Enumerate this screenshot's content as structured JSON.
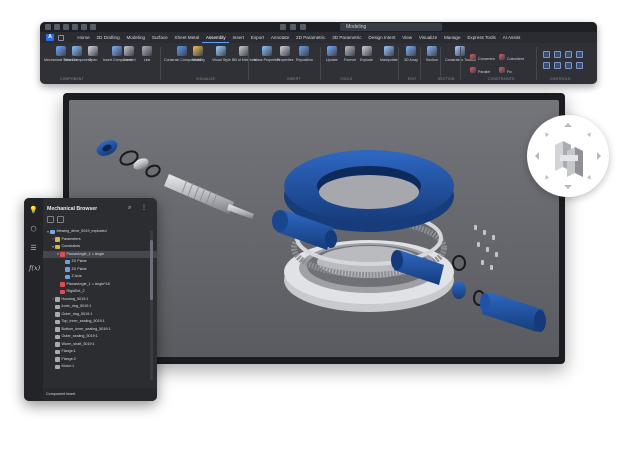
{
  "ribbon": {
    "document_name": "Modeling",
    "app_button": "A",
    "tabs": [
      "Home",
      "2D Drafting",
      "Modeling",
      "Surface",
      "Sheet Metal",
      "Assembly",
      "Insert",
      "Export",
      "Annotate",
      "2D Parametric",
      "3D Parametric",
      "Design Intent",
      "View",
      "Visualize",
      "Manage",
      "Express Tools",
      "AI Assist"
    ],
    "active_tab": "Assembly",
    "tools": [
      {
        "label": "Mechanical Structure",
        "icon": "mechanical-structure-icon"
      },
      {
        "label": "New Component",
        "icon": "new-component-icon"
      },
      {
        "label": "Open",
        "icon": "open-icon"
      },
      {
        "label": "Insert Component",
        "icon": "insert-component-icon"
      },
      {
        "label": "Convert",
        "icon": "convert-icon"
      },
      {
        "label": "Link",
        "icon": "link-icon"
      },
      {
        "label": "Constrain Components",
        "icon": "constrain-components-icon"
      },
      {
        "label": "Visibility",
        "icon": "visibility-icon"
      },
      {
        "label": "Visual Style",
        "icon": "visual-style-icon"
      },
      {
        "label": "Bill of Materials",
        "icon": "bill-of-materials-icon"
      },
      {
        "label": "Mass Properties",
        "icon": "mass-properties-icon"
      },
      {
        "label": "Properties",
        "icon": "properties-icon"
      },
      {
        "label": "Reposition",
        "icon": "reposition-icon"
      },
      {
        "label": "Update",
        "icon": "update-icon"
      },
      {
        "label": "Forever",
        "icon": "forever-icon"
      },
      {
        "label": "Explode",
        "icon": "explode-icon"
      },
      {
        "label": "Manipulate",
        "icon": "manipulate-icon"
      },
      {
        "label": "3D Array",
        "icon": "3d-array-icon"
      },
      {
        "label": "Section",
        "icon": "section-icon"
      },
      {
        "label": "Constraints Toolbar",
        "icon": "constraints-toolbar-icon"
      },
      {
        "label": "Concentric",
        "icon": "concentric-icon"
      },
      {
        "label": "Parallel",
        "icon": "parallel-icon"
      },
      {
        "label": "Coincident",
        "icon": "coincident-icon"
      },
      {
        "label": "Fix",
        "icon": "fix-icon"
      }
    ],
    "groups": [
      "COMPONENT",
      "VISUALIZE",
      "INSERT",
      "TOOLS",
      "EDIT",
      "SECTION",
      "CONSTRAINTS",
      "CONTROLS"
    ]
  },
  "browser": {
    "title": "Mechanical Browser",
    "side_icons": [
      "lightbulb-icon",
      "cube-icon",
      "tree-icon"
    ],
    "side_fx": "f(x)",
    "tree": [
      {
        "level": 0,
        "twisty": "▾",
        "icon": "assembly",
        "label": "Mewing_drive_5019_exploded"
      },
      {
        "level": 1,
        "twisty": "›",
        "icon": "folder",
        "label": "Parameters"
      },
      {
        "level": 1,
        "twisty": "▾",
        "icon": "folder",
        "label": "Constraints"
      },
      {
        "level": 2,
        "twisty": "▾",
        "icon": "constraint",
        "label": "PlanarAngle_1 = Angle",
        "selected": true
      },
      {
        "level": 3,
        "twisty": "",
        "icon": "plane",
        "label": "ZX Plane"
      },
      {
        "level": 3,
        "twisty": "",
        "icon": "plane",
        "label": "ZX Plane"
      },
      {
        "level": 3,
        "twisty": "",
        "icon": "axis",
        "label": "Z Axis"
      },
      {
        "level": 2,
        "twisty": "",
        "icon": "constraint",
        "label": "PlanarAngle_1 = Angle*18"
      },
      {
        "level": 2,
        "twisty": "",
        "icon": "constraint",
        "label": "RigidSet_2"
      },
      {
        "level": 1,
        "twisty": "›",
        "icon": "part",
        "label": "Housing_5019:1"
      },
      {
        "level": 1,
        "twisty": "",
        "icon": "part",
        "label": "Inner_ring_5019:1"
      },
      {
        "level": 1,
        "twisty": "",
        "icon": "part",
        "label": "Outer_ring_5019:1"
      },
      {
        "level": 1,
        "twisty": "",
        "icon": "part",
        "label": "Top_inner_sealing_5019:1"
      },
      {
        "level": 1,
        "twisty": "",
        "icon": "part",
        "label": "Bottom_inner_sealing_5019:1"
      },
      {
        "level": 1,
        "twisty": "",
        "icon": "part",
        "label": "Outer_sealing_5019:1"
      },
      {
        "level": 1,
        "twisty": "",
        "icon": "part",
        "label": "Worm_shaft_5019:1"
      },
      {
        "level": 1,
        "twisty": "",
        "icon": "part",
        "label": "Flange:1"
      },
      {
        "level": 1,
        "twisty": "",
        "icon": "part",
        "label": "Flange:2"
      },
      {
        "level": 1,
        "twisty": "",
        "icon": "part",
        "label": "Motor:1"
      }
    ],
    "footer": "Component Insert"
  },
  "colors": {
    "accent": "#2f6de0",
    "part_blue": "#1f4f9b",
    "viewport_bg": "#66676c",
    "panel_bg": "#2b2d31"
  }
}
